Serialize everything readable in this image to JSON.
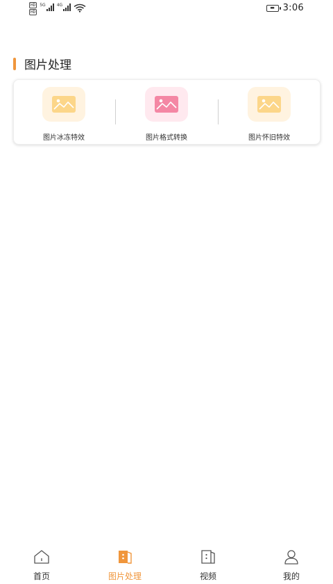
{
  "status_bar": {
    "hd1": "HD",
    "hd2": "HD",
    "net1": "5G",
    "net2": "4G",
    "battery": "▬",
    "time": "3:06"
  },
  "section": {
    "title": "图片处理"
  },
  "tools": [
    {
      "label": "图片冰冻特效",
      "icon": "image-icon",
      "bg": "#fff3e0",
      "tile": "#fcd689"
    },
    {
      "label": "图片格式转换",
      "icon": "image-icon",
      "bg": "#ffe9ef",
      "tile": "#f487a4"
    },
    {
      "label": "图片怀旧特效",
      "icon": "image-icon",
      "bg": "#fff3e0",
      "tile": "#fcd689"
    }
  ],
  "nav": {
    "items": [
      {
        "label": "首页",
        "icon": "home-icon",
        "active": false
      },
      {
        "label": "图片处理",
        "icon": "image-process-icon",
        "active": true
      },
      {
        "label": "视频",
        "icon": "video-icon",
        "active": false
      },
      {
        "label": "我的",
        "icon": "profile-icon",
        "active": false
      }
    ]
  },
  "colors": {
    "accent": "#f0963c",
    "text": "#222222"
  }
}
